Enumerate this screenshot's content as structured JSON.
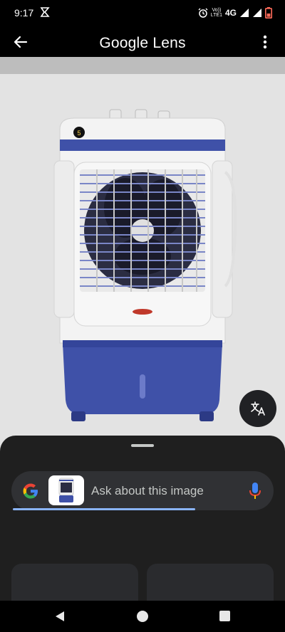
{
  "status_bar": {
    "time": "9:17",
    "network": "4G",
    "volte_top": "Vo))",
    "volte_bottom": "LTE1",
    "icons": [
      "notification-icon",
      "alarm-icon",
      "signal-icon",
      "battery-icon"
    ],
    "battery_color": "#ff6b5a"
  },
  "app_bar": {
    "title_google": "Google",
    "title_lens": "Lens",
    "back_icon": "arrow-back-icon",
    "more_icon": "more-vert-icon"
  },
  "image": {
    "subject": "air cooler product photo",
    "accent": "#3f51a8"
  },
  "translate_icon": "translate-icon",
  "search": {
    "placeholder": "Ask about this image",
    "google_icon": "google-g-icon",
    "mic_icon": "mic-icon"
  },
  "nav": {
    "back_icon": "nav-back-icon",
    "home_icon": "nav-home-icon",
    "recents_icon": "nav-recents-icon"
  }
}
